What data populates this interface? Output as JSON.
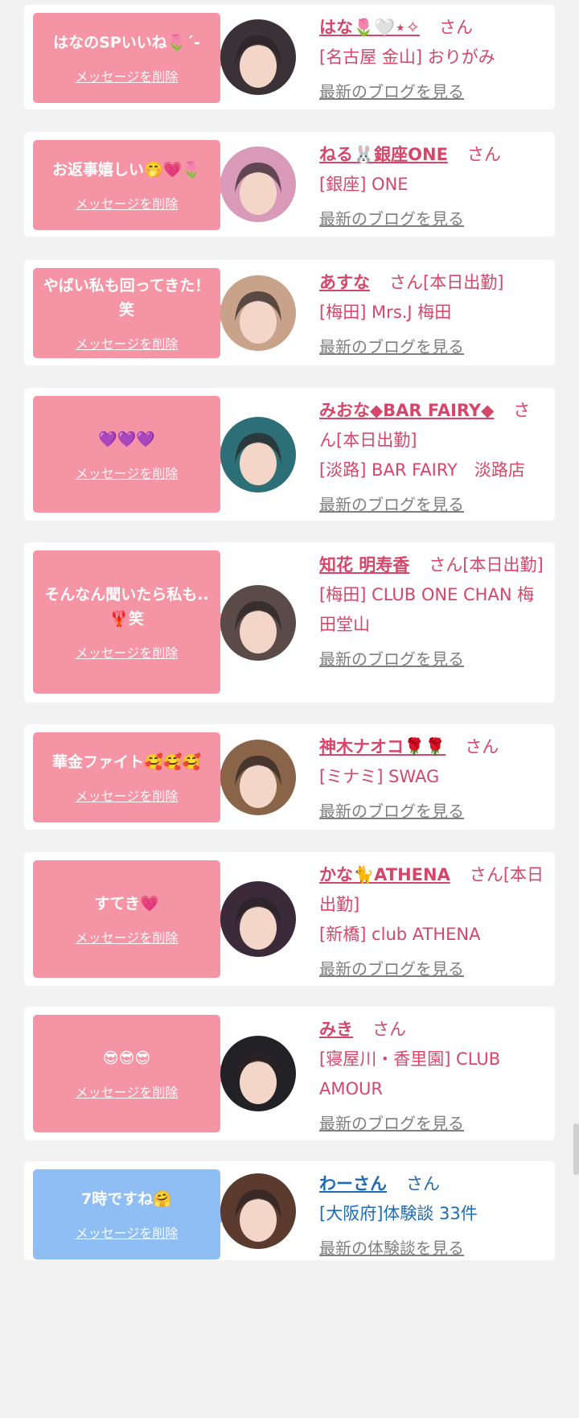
{
  "items": [
    {
      "message": "はなのSPいいね🌷´-",
      "delete_label": "メッセージを削除",
      "name": "はな🌷🤍⋆✧",
      "san": "さん",
      "shop": "[名古屋 金山] おりがみ",
      "link": "最新のブログを見る",
      "bubble": "pink",
      "avatar_color": "#3a3236"
    },
    {
      "message": "お返事嬉しい🤭💗🌷",
      "delete_label": "メッセージを削除",
      "name": "ねる🐰銀座ONE",
      "san": "さん",
      "shop": "[銀座] ONE",
      "link": "最新のブログを見る",
      "bubble": "pink",
      "avatar_color": "#d99aba"
    },
    {
      "message": "やばい私も回ってきた！笑",
      "delete_label": "メッセージを削除",
      "name": "あすな",
      "san": "さん[本日出勤]",
      "shop": "[梅田] Mrs.J 梅田",
      "link": "最新のブログを見る",
      "bubble": "pink",
      "avatar_color": "#c9a28a"
    },
    {
      "message": "💜💜💜",
      "delete_label": "メッセージを削除",
      "name": "みおな◆BAR FAIRY◆",
      "san": "さん[本日出勤]",
      "shop": "[淡路] BAR FAIRY　淡路店",
      "link": "最新のブログを見る",
      "bubble": "pink",
      "avatar_color": "#2c6f77"
    },
    {
      "message": "そんなん聞いたら私も..🦞笑",
      "delete_label": "メッセージを削除",
      "name": "知花 明寿香",
      "san": "さん[本日出勤]",
      "shop": "[梅田] CLUB ONE CHAN 梅田堂山",
      "link": "最新のブログを見る",
      "bubble": "pink",
      "avatar_color": "#5a4a48"
    },
    {
      "message": "華金ファイト🥰🥰🥰",
      "delete_label": "メッセージを削除",
      "name": "神木ナオコ🌹🌹",
      "san": "さん",
      "shop": "[ミナミ] SWAG",
      "link": "最新のブログを見る",
      "bubble": "pink",
      "avatar_color": "#8a6448"
    },
    {
      "message": "すてき💗",
      "delete_label": "メッセージを削除",
      "name": "かな🐈ATHENA",
      "san": "さん[本日出勤]",
      "shop": "[新橋] club ATHENA",
      "link": "最新のブログを見る",
      "bubble": "pink",
      "avatar_color": "#3b2a3a"
    },
    {
      "message": "😎😎😎",
      "delete_label": "メッセージを削除",
      "name": "みき",
      "san": "さん",
      "shop": "[寝屋川・香里園] CLUB AMOUR",
      "link": "最新のブログを見る",
      "bubble": "pink",
      "avatar_color": "#222226"
    },
    {
      "message": "7時ですね🤗",
      "delete_label": "メッセージを削除",
      "name": "わーさん",
      "san": "さん",
      "shop": "[大阪府]体験談 33件",
      "link": "最新の体験談を見る",
      "bubble": "blue",
      "avatar_color": "#5b3b2e"
    }
  ]
}
